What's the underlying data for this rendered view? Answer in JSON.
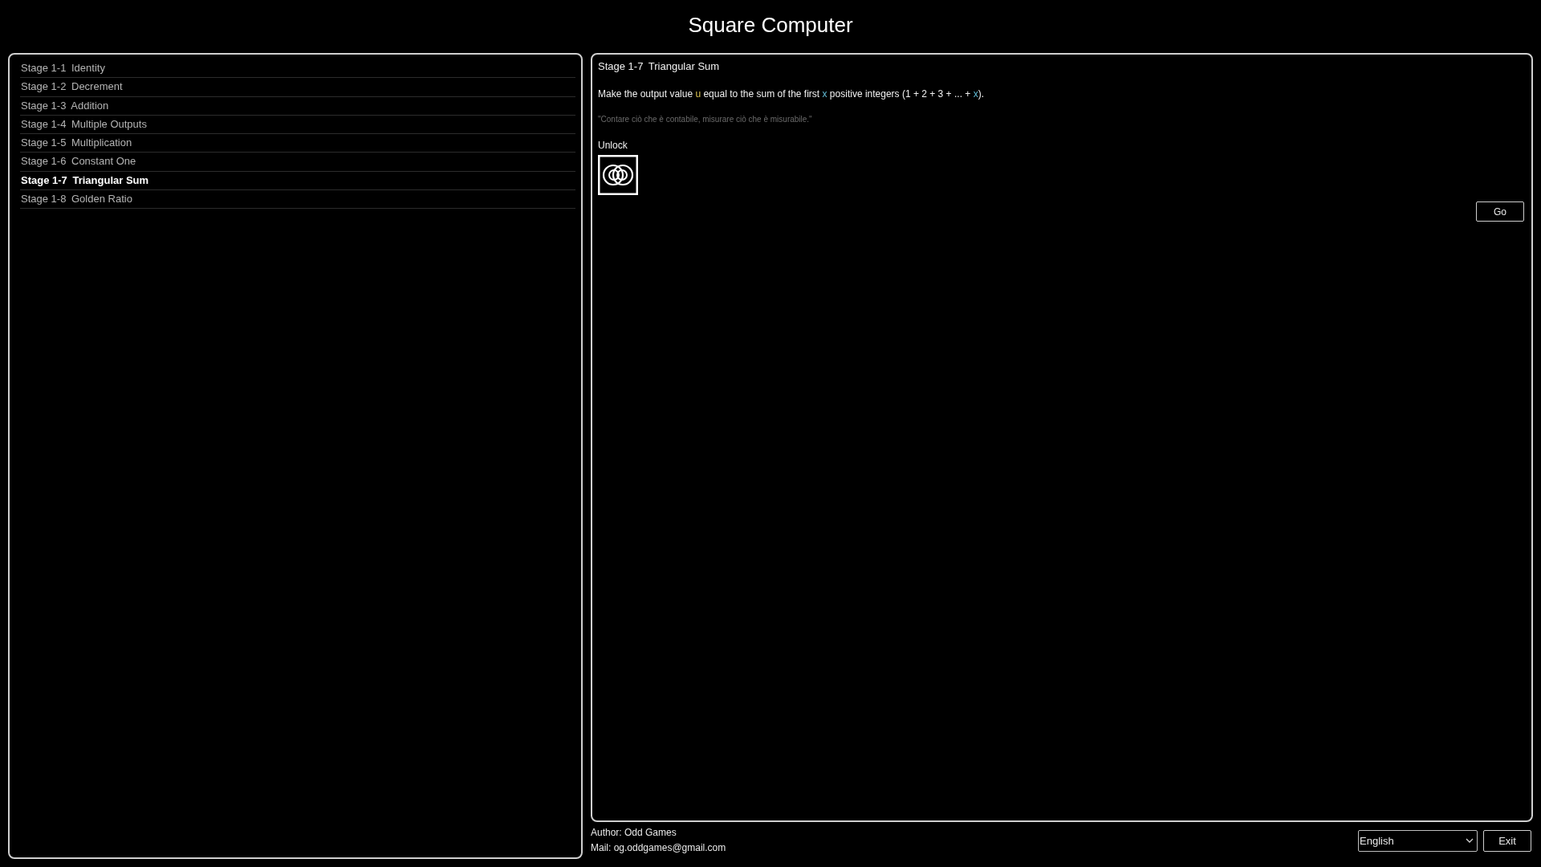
{
  "window": {
    "title": "Square Computer"
  },
  "stages": [
    {
      "code": "Stage 1-1",
      "name": "Identity",
      "selected": false
    },
    {
      "code": "Stage 1-2",
      "name": "Decrement",
      "selected": false
    },
    {
      "code": "Stage 1-3",
      "name": "Addition",
      "selected": false
    },
    {
      "code": "Stage 1-4",
      "name": "Multiple Outputs",
      "selected": false
    },
    {
      "code": "Stage 1-5",
      "name": "Multiplication",
      "selected": false
    },
    {
      "code": "Stage 1-6",
      "name": "Constant One",
      "selected": false
    },
    {
      "code": "Stage 1-7",
      "name": "Triangular Sum",
      "selected": true
    },
    {
      "code": "Stage 1-8",
      "name": "Golden Ratio",
      "selected": false
    }
  ],
  "detail": {
    "code": "Stage 1-7",
    "name": "Triangular Sum",
    "description": [
      {
        "kind": "text",
        "text": "Make the output value "
      },
      {
        "kind": "output",
        "text": "u"
      },
      {
        "kind": "text",
        "text": " equal to the sum of the first "
      },
      {
        "kind": "input",
        "text": "x"
      },
      {
        "kind": "text",
        "text": " positive integers (1 + 2 + 3 + ... + "
      },
      {
        "kind": "input",
        "text": "x"
      },
      {
        "kind": "text",
        "text": ")."
      }
    ],
    "quote": "\"Contare ciò che è contabile, misurare ciò che è misurabile.\"",
    "unlock_label": "Unlock",
    "go_button": "Go"
  },
  "footer": {
    "author": "Author: Odd Games",
    "mail": "Mail: og.oddgames@gmail.com",
    "language": {
      "value": "English"
    },
    "exit_button": "Exit"
  }
}
